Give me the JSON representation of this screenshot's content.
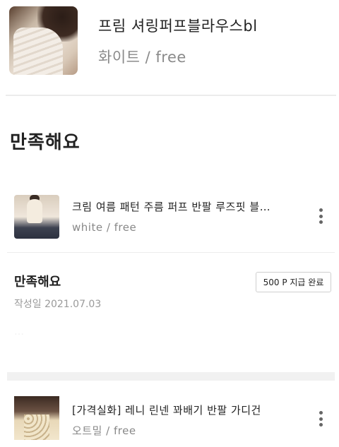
{
  "product": {
    "title": "프림 셔링퍼프블라우스bl",
    "option": "화이트 / free"
  },
  "section": {
    "heading": "만족해요"
  },
  "reviewed_item": {
    "name": "크림 여름 패턴 주름 퍼프 반팔 루즈핏 블…",
    "option": "white / free"
  },
  "review": {
    "title": "만족해요",
    "point_status": "500 P 지급 완료",
    "date": "작성일 2021.07.03",
    "body": "…"
  },
  "next_item": {
    "name": "[가격실화] 레니 린넨 꽈배기 반팔 가디건",
    "option": "오트밀 / free"
  },
  "icons": {
    "more": "more-vertical-icon"
  },
  "colors": {
    "text": "#222222",
    "muted": "#8a8a8a",
    "divider": "#ececec"
  }
}
